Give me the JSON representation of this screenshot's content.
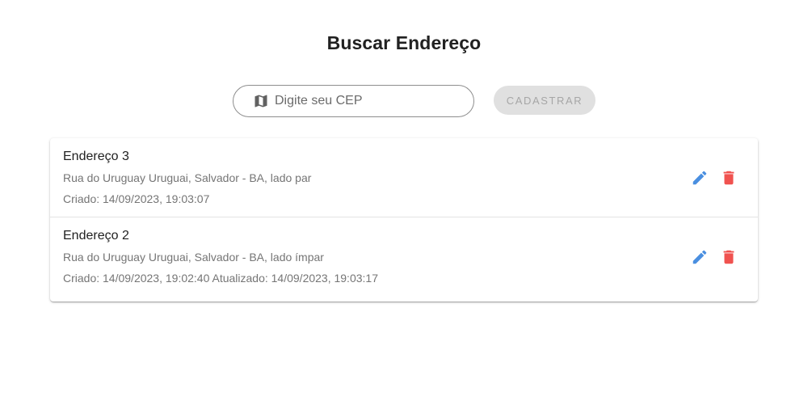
{
  "header": {
    "title": "Buscar Endereço"
  },
  "search": {
    "placeholder": "Digite seu CEP",
    "value": "",
    "icon": "map-icon"
  },
  "actions": {
    "register_label": "CADASTRAR"
  },
  "colors": {
    "edit_icon": "#4a8fe0",
    "delete_icon": "#f0524f",
    "button_disabled_bg": "#e0e0e0",
    "button_disabled_text": "#a6a6a6"
  },
  "addresses": [
    {
      "title": "Endereço 3",
      "description": "Rua do Uruguay Uruguai, Salvador - BA, lado par",
      "timestamps": "Criado: 14/09/2023, 19:03:07"
    },
    {
      "title": "Endereço 2",
      "description": "Rua do Uruguay Uruguai, Salvador - BA, lado ímpar",
      "timestamps": "Criado: 14/09/2023, 19:02:40 Atualizado: 14/09/2023, 19:03:17"
    }
  ]
}
